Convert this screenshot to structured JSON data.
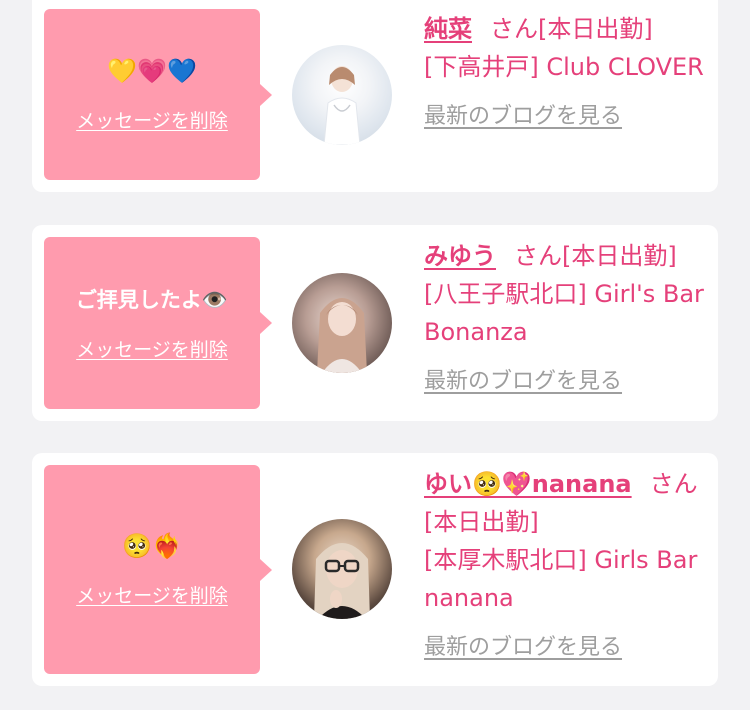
{
  "messages": [
    {
      "bubble_emoji": "💛💗💙",
      "bubble_text": "",
      "delete_label": "メッセージを削除",
      "cast_name": "純菜",
      "honorific": "さん[本日出勤]",
      "shop": "[下高井戸] Club CLOVER",
      "blog_label": "最新のブログを見る"
    },
    {
      "bubble_emoji": "",
      "bubble_text": "ご拝見したよ👁️",
      "delete_label": "メッセージを削除",
      "cast_name": "みゆう",
      "honorific": "さん[本日出勤]",
      "shop": "[八王子駅北口] Girl's Bar Bonanza",
      "blog_label": "最新のブログを見る"
    },
    {
      "bubble_emoji": "🥺❤️‍🔥",
      "bubble_text": "",
      "delete_label": "メッセージを削除",
      "cast_name": "ゆい🥺💖nanana",
      "honorific": "さん[本日出勤]",
      "shop": "[本厚木駅北口] Girls Bar nanana",
      "blog_label": "最新のブログを見る"
    }
  ],
  "colors": {
    "bubble": "#ff9bae",
    "accent": "#e5407a",
    "link_gray": "#9e9e9e",
    "background": "#f2f2f4"
  }
}
